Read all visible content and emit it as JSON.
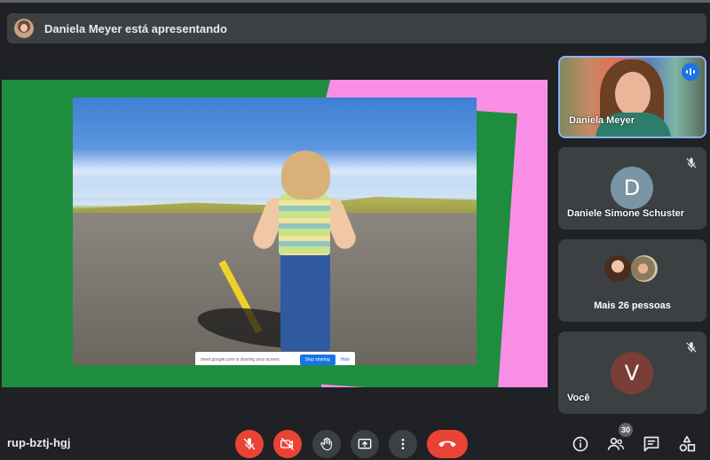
{
  "banner": {
    "text": "Daniela Meyer está apresentando"
  },
  "share_bar": {
    "text": "meet.google.com is sharing your screen.",
    "stop_label": "Stop sharing",
    "hide_label": "Hide"
  },
  "tiles": [
    {
      "name": "Daniela Meyer",
      "speaking": true
    },
    {
      "name": "Daniele Simone Schuster",
      "initial": "D",
      "muted": true
    },
    {
      "name": "Mais 26 pessoas"
    },
    {
      "name": "Você",
      "initial": "V",
      "muted": true
    }
  ],
  "meeting": {
    "code": "rup-bztj-hgj"
  },
  "participants_count": "30",
  "colors": {
    "background": "#202124",
    "tile": "#3c4043",
    "accent_red": "#ea4335",
    "accent_blue": "#1a73e8",
    "stage_green": "#1e8e3e",
    "stage_pink": "#f88ee6"
  },
  "controls": [
    {
      "icon": "mic-off-icon",
      "active_red": true
    },
    {
      "icon": "camera-off-icon",
      "active_red": true
    },
    {
      "icon": "raise-hand-icon"
    },
    {
      "icon": "present-screen-icon"
    },
    {
      "icon": "more-options-icon"
    },
    {
      "icon": "end-call-icon"
    }
  ],
  "right_controls": [
    {
      "icon": "info-icon"
    },
    {
      "icon": "people-icon"
    },
    {
      "icon": "chat-icon"
    },
    {
      "icon": "activities-icon"
    }
  ]
}
